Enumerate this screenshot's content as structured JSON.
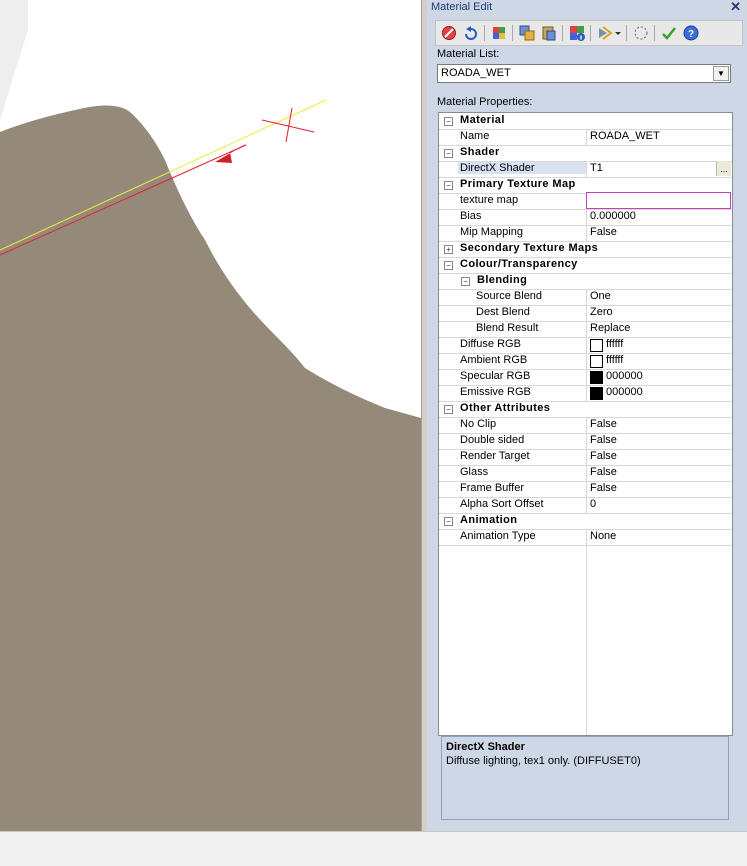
{
  "panel": {
    "title": "Material Edit",
    "close_glyph": "✕",
    "material_list_label": "Material List:",
    "material_selected": "ROADA_WET",
    "properties_label": "Material Properties:"
  },
  "toolbar_icons": [
    "cancel-icon",
    "undo-icon",
    "new-material-icon",
    "copy-icon",
    "paste-icon",
    "material-info-icon",
    "material-dropdown-icon",
    "select-circle-icon",
    "apply-check-icon",
    "help-icon"
  ],
  "properties": {
    "material_cat": "Material",
    "name_label": "Name",
    "name_value": "ROADA_WET",
    "shader_cat": "Shader",
    "dx_label": "DirectX Shader",
    "dx_value": "T1",
    "dx_ellipsis": "...",
    "ptm_cat": "Primary Texture Map",
    "texmap_label": "texture map",
    "texmap_value": "",
    "bias_label": "Bias",
    "bias_value": "0.000000",
    "mip_label": "Mip Mapping",
    "mip_value": "False",
    "stm_cat": "Secondary Texture Maps",
    "colour_cat": "Colour/Transparency",
    "blending_cat": "Blending",
    "srcblend_label": "Source Blend",
    "srcblend_value": "One",
    "dstblend_label": "Dest Blend",
    "dstblend_value": "Zero",
    "blendres_label": "Blend Result",
    "blendres_value": "Replace",
    "diffuse_label": "Diffuse RGB",
    "diffuse_value": "ffffff",
    "ambient_label": "Ambient RGB",
    "ambient_value": "ffffff",
    "specular_label": "Specular RGB",
    "specular_value": "000000",
    "emissive_label": "Emissive RGB",
    "emissive_value": "000000",
    "other_cat": "Other Attributes",
    "noclip_label": "No Clip",
    "noclip_value": "False",
    "double_label": "Double sided",
    "double_value": "False",
    "rtarget_label": "Render Target",
    "rtarget_value": "False",
    "glass_label": "Glass",
    "glass_value": "False",
    "fbuffer_label": "Frame Buffer",
    "fbuffer_value": "False",
    "alpha_label": "Alpha Sort Offset",
    "alpha_value": "0",
    "anim_cat": "Animation",
    "animtype_label": "Animation Type",
    "animtype_value": "None"
  },
  "help": {
    "title": "DirectX Shader",
    "description": "Diffuse lighting, tex1 only. (DIFFUSET0)"
  },
  "colors": {
    "terrain": "#958a79",
    "panel_bg": "#ced7e6",
    "diffuse_swatch": "#ffffff",
    "ambient_swatch": "#ffffff",
    "specular_swatch": "#000000",
    "emissive_swatch": "#000000",
    "axis_yellow": "#f2ea3a",
    "axis_red": "#e0202a"
  },
  "state": {
    "material_expanded": "−",
    "shader_expanded": "−",
    "ptm_expanded": "−",
    "stm_collapsed": "+",
    "colour_expanded": "−",
    "blending_expanded": "−",
    "other_expanded": "−",
    "anim_expanded": "−"
  }
}
